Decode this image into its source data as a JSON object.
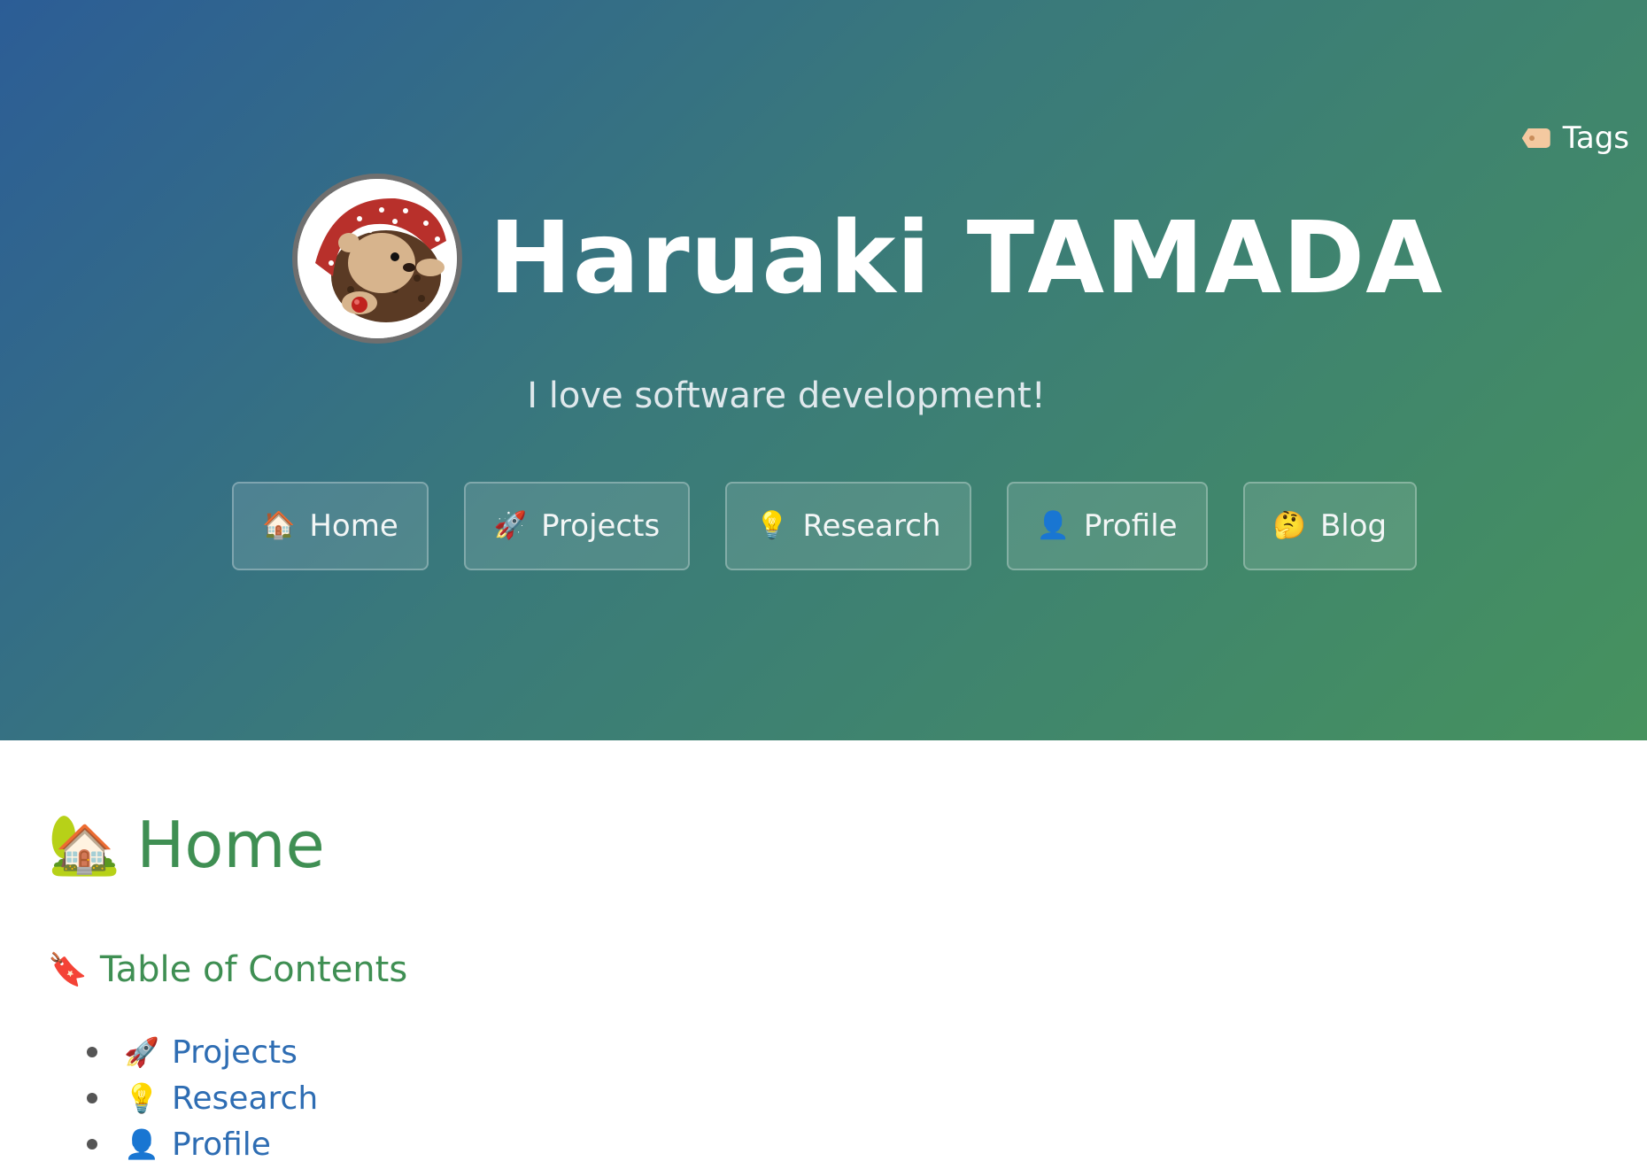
{
  "header": {
    "tags": {
      "icon": "tag-icon",
      "label": "Tags"
    },
    "title": "Haruaki TAMADA",
    "tagline": "I love software development!",
    "nav": [
      {
        "icon": "house-icon",
        "glyph": "🏠",
        "label": "Home"
      },
      {
        "icon": "rocket-icon",
        "glyph": "🚀",
        "label": "Projects"
      },
      {
        "icon": "lightbulb-icon",
        "glyph": "💡",
        "label": "Research"
      },
      {
        "icon": "person-icon",
        "glyph": "👤",
        "label": "Profile"
      },
      {
        "icon": "thinking-face-icon",
        "glyph": "🤔",
        "label": "Blog"
      }
    ]
  },
  "main": {
    "page_title": {
      "icon": "house-with-garden-icon",
      "glyph": "🏡",
      "label": "Home"
    },
    "toc": {
      "icon": "bookmark-tag-icon",
      "glyph": "🔖",
      "heading": "Table of Contents",
      "items": [
        {
          "icon": "rocket-icon",
          "glyph": "🚀",
          "label": "Projects"
        },
        {
          "icon": "lightbulb-icon",
          "glyph": "💡",
          "label": "Research"
        },
        {
          "icon": "person-icon",
          "glyph": "👤",
          "label": "Profile"
        }
      ]
    }
  },
  "colors": {
    "gradient_start": "#2c5d96",
    "gradient_end": "#46925e",
    "heading_green": "#3f8f53",
    "link_blue": "#2e6db3"
  }
}
